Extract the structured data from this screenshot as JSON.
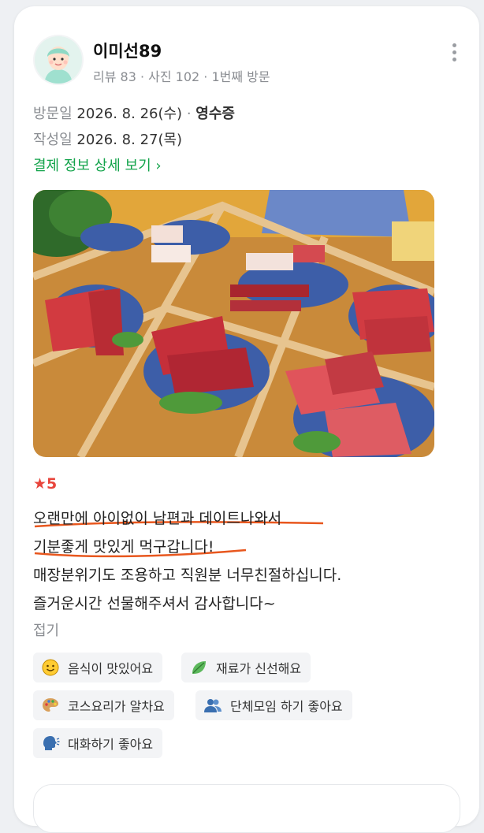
{
  "reviewer": {
    "name": "이미선89",
    "meta": "리뷰 83 · 사진 102 · 1번째 방문"
  },
  "visit": {
    "visit_label": "방문일",
    "visit_date": "2026. 8. 26(수)",
    "separator": " · ",
    "receipt_label": "영수증",
    "written_label": "작성일",
    "written_date": "2026. 8. 27(목)"
  },
  "payment_link": "결제 정보 상세 보기 ›",
  "rating": {
    "star": "★",
    "value": "5"
  },
  "review_lines": [
    "오랜만에 아이없이 남편과 데이트나와서",
    "기분좋게 맛있게 먹구갑니다!",
    "매장분위기도 조용하고 직원분 너무친절하십니다.",
    "즐거운시간 선물해주셔서 감사합니다~"
  ],
  "fold_label": "접기",
  "tags": [
    {
      "icon": "smiley-face-icon",
      "label": "음식이 맛있어요"
    },
    {
      "icon": "leaf-icon",
      "label": "재료가 신선해요"
    },
    {
      "icon": "palette-icon",
      "label": "코스요리가 알차요"
    },
    {
      "icon": "people-icon",
      "label": "단체모임 하기 좋아요"
    },
    {
      "icon": "talking-head-icon",
      "label": "대화하기 좋아요"
    }
  ],
  "colors": {
    "link_green": "#12a34a",
    "star_red": "#e8453c",
    "underline_orange": "#e8571e"
  }
}
